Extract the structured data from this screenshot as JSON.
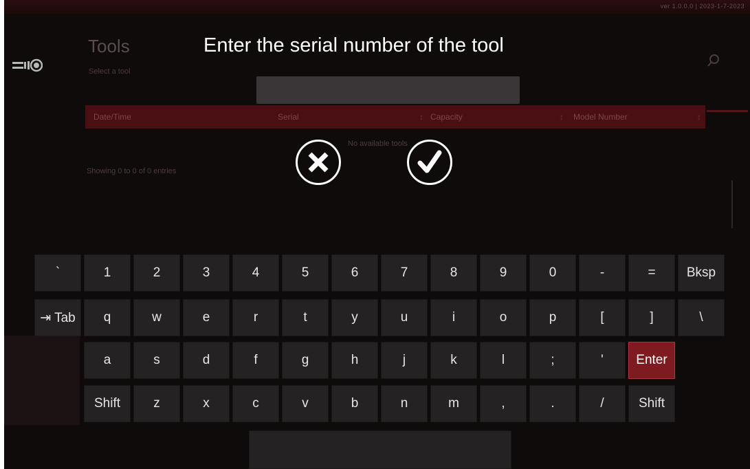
{
  "background": {
    "version_text": "ver 1.0.0.0 | 2023-1-7-2023",
    "title": "Tools",
    "subtitle": "Select a tool",
    "table_headers": [
      "Date/Time",
      "Serial",
      "Capacity",
      "Model Number"
    ],
    "empty_text": "No available tools",
    "showing_text": "Showing 0 to 0 of 0 entries"
  },
  "prompt": "Enter the serial number of the tool",
  "buttons": {
    "cancel_icon": "close-icon",
    "confirm_icon": "check-icon"
  },
  "keyboard": {
    "rows": [
      [
        "`",
        "1",
        "2",
        "3",
        "4",
        "5",
        "6",
        "7",
        "8",
        "9",
        "0",
        "-",
        "=",
        "Bksp"
      ],
      [
        "⇥ Tab",
        "q",
        "w",
        "e",
        "r",
        "t",
        "y",
        "u",
        "i",
        "o",
        "p",
        "[",
        "]",
        "\\"
      ],
      [
        "a",
        "s",
        "d",
        "f",
        "g",
        "h",
        "j",
        "k",
        "l",
        ";",
        "'",
        "Enter"
      ],
      [
        "Shift",
        "z",
        "x",
        "c",
        "v",
        "b",
        "n",
        "m",
        ",",
        ".",
        "/",
        "Shift"
      ]
    ],
    "accent_key": "Enter",
    "accent_color": "#7e1b21"
  }
}
